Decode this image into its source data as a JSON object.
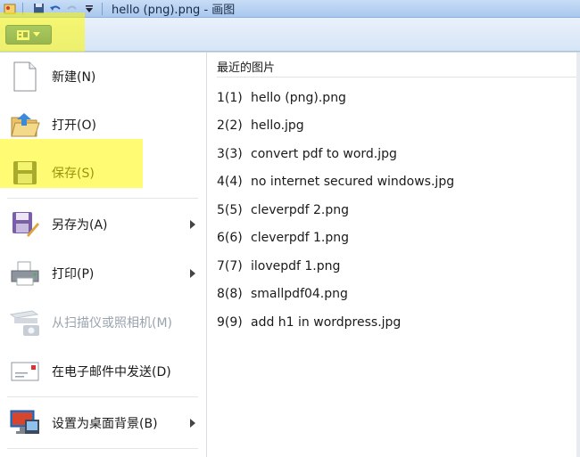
{
  "window": {
    "title": "hello (png).png - 画图"
  },
  "menu": {
    "items": [
      {
        "label": "新建(N)",
        "icon": "new-file-icon",
        "disabled": false,
        "submenu": false
      },
      {
        "label": "打开(O)",
        "icon": "open-folder-icon",
        "disabled": false,
        "submenu": false
      },
      {
        "label": "保存(S)",
        "icon": "save-floppy-icon",
        "disabled": false,
        "submenu": false
      },
      {
        "label": "另存为(A)",
        "icon": "save-as-icon",
        "disabled": false,
        "submenu": true
      },
      {
        "label": "打印(P)",
        "icon": "printer-icon",
        "disabled": false,
        "submenu": true
      },
      {
        "label": "从扫描仪或照相机(M)",
        "icon": "scanner-icon",
        "disabled": true,
        "submenu": false
      },
      {
        "label": "在电子邮件中发送(D)",
        "icon": "email-icon",
        "disabled": false,
        "submenu": false
      },
      {
        "label": "设置为桌面背景(B)",
        "icon": "desktop-background-icon",
        "disabled": false,
        "submenu": true
      }
    ]
  },
  "recent": {
    "title": "最近的图片",
    "files": [
      {
        "num": "1(1)",
        "name": "hello (png).png"
      },
      {
        "num": "2(2)",
        "name": "hello.jpg"
      },
      {
        "num": "3(3)",
        "name": "convert pdf to word.jpg"
      },
      {
        "num": "4(4)",
        "name": "no internet secured windows.jpg"
      },
      {
        "num": "5(5)",
        "name": "cleverpdf 2.png"
      },
      {
        "num": "6(6)",
        "name": "cleverpdf 1.png"
      },
      {
        "num": "7(7)",
        "name": "ilovepdf 1.png"
      },
      {
        "num": "8(8)",
        "name": "smallpdf04.png"
      },
      {
        "num": "9(9)",
        "name": "add h1 in wordpress.jpg"
      }
    ]
  },
  "colors": {
    "highlight": "#fffa00",
    "app_button": "#1f65b1"
  }
}
